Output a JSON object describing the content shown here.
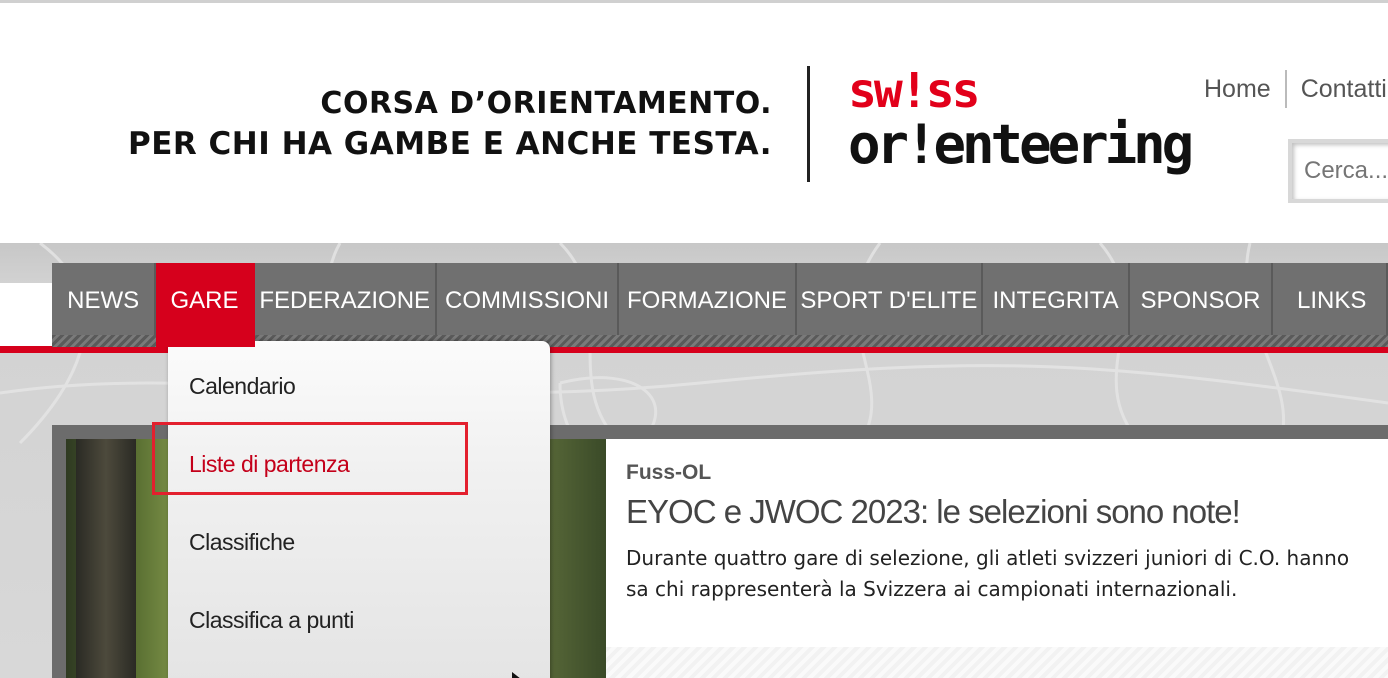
{
  "header": {
    "slogan_line1": "CORSA D’ORIENTAMENTO.",
    "slogan_line2": "PER CHI HA GAMBE E ANCHE TESTA.",
    "logo_top": "sw!ss",
    "logo_bottom": "or!enteering",
    "top_links": [
      "Home",
      "Contatti"
    ],
    "search_placeholder": "Cerca..."
  },
  "nav": {
    "items": [
      "NEWS",
      "GARE",
      "FEDERAZIONE",
      "COMMISSIONI",
      "FORMAZIONE",
      "SPORT D'ELITE",
      "INTEGRITA",
      "SPONSOR",
      "LINKS"
    ],
    "active": "GARE"
  },
  "dropdown": {
    "items": [
      "Calendario",
      "Liste di partenza",
      "Classifiche",
      "Classifica a punti"
    ],
    "selected": "Liste di partenza"
  },
  "article": {
    "category": "Fuss-OL",
    "title": "EYOC e JWOC 2023: le selezioni sono note!",
    "text_line1": "Durante quattro gare di selezione, gli atleti svizzeri juniori di C.O. hanno",
    "text_line2": "sa chi rappresenterà la Svizzera ai campionati internazionali."
  },
  "colors": {
    "brand_red": "#d6001c",
    "nav_gray": "#707070",
    "highlight": "#e3202e"
  }
}
